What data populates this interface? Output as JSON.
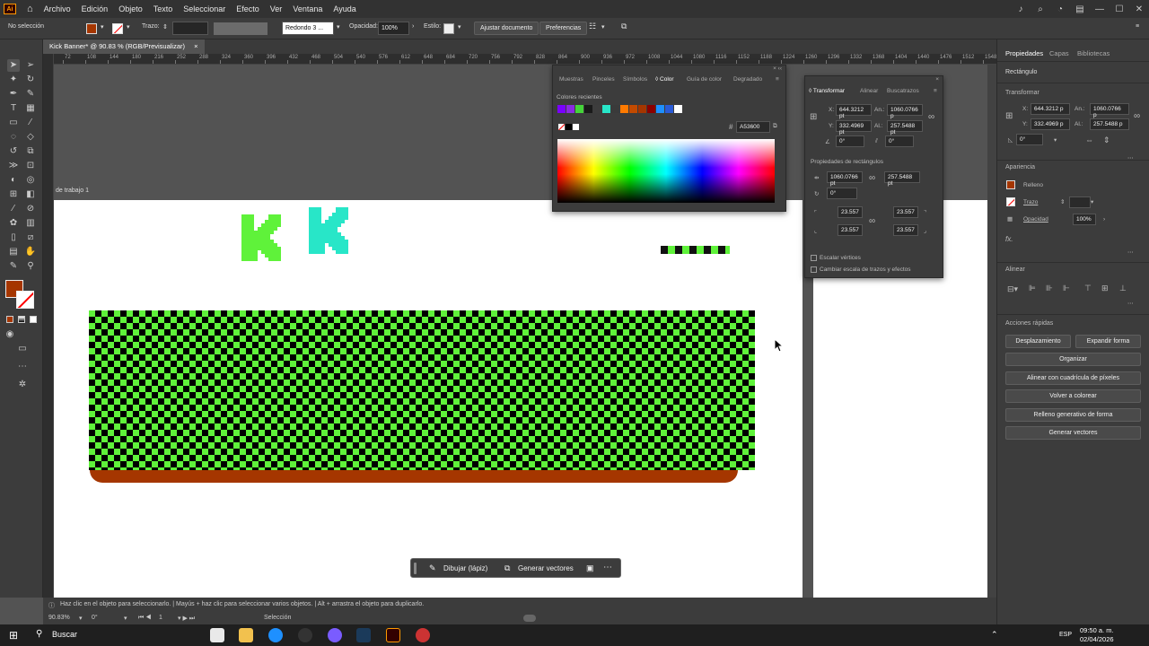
{
  "menubar": {
    "app_logo": "Ai",
    "items": [
      "Archivo",
      "Edición",
      "Objeto",
      "Texto",
      "Seleccionar",
      "Efecto",
      "Ver",
      "Ventana",
      "Ayuda"
    ]
  },
  "control_bar": {
    "selection": "No selección",
    "stroke_label": "Trazo:",
    "brush": "Redondo 3 ...",
    "opacity_label": "Opacidad:",
    "opacity_value": "100%",
    "style_label": "Estilo:",
    "fit_document": "Ajustar documento",
    "preferences": "Preferencias",
    "fill_color": "#a53600"
  },
  "document_tab": {
    "title": "Kick Banner* @ 90.83 % (RGB/Previsualizar)",
    "close": "×"
  },
  "ruler": {
    "ticks": [
      "72",
      "108",
      "144",
      "180",
      "216",
      "252",
      "288",
      "324",
      "360",
      "396",
      "432",
      "468",
      "504",
      "540",
      "576",
      "612",
      "648",
      "684",
      "720",
      "756",
      "792",
      "828",
      "864",
      "900",
      "936",
      "972",
      "1008",
      "1044",
      "1080",
      "1116",
      "1152",
      "1188",
      "1224",
      "1260",
      "1296",
      "1332",
      "1368",
      "1404",
      "1440",
      "1476",
      "1512",
      "1548"
    ]
  },
  "canvas": {
    "artboard_label": "de trabajo 1",
    "kick_letters": [
      "K",
      "K"
    ],
    "checker_green": "#5ff23a",
    "ground_color": "#a53600"
  },
  "color_panel": {
    "tabs": [
      "Muestras",
      "Pinceles",
      "Símbolos",
      "Color",
      "Guía de color",
      "Degradado"
    ],
    "active_tab": "Color",
    "recent_label": "Colores recientes",
    "recent_colors": [
      "#7a00ff",
      "#8a2be2",
      "#45d43a",
      "#1a1a1a",
      "#3d3d3d",
      "#28e6c8",
      "#3a3a3a",
      "#ff7a00",
      "#c24a00",
      "#a53600",
      "#8b0000",
      "#1e90ff",
      "#2a5bd7",
      "#ffffff"
    ],
    "hex_value": "A53600"
  },
  "transform_panel": {
    "tabs": [
      "Transformar",
      "Alinear",
      "Buscatrazos"
    ],
    "x": "644.3212 pt",
    "y": "332.4969 pt",
    "w": "1060.0766 p",
    "h": "257.5488 pt",
    "angle": "0°",
    "shear": "0°",
    "rect_props_label": "Propiedades de rectángulos",
    "rect_w": "1060.0766 pt",
    "rect_h": "257.5488 pt",
    "rect_angle": "0°",
    "radius_1": "23.557",
    "radius_2": "23.557",
    "radius_3": "23.557",
    "radius_4": "23.557",
    "scale_corners": "Escalar vértices",
    "scale_strokes": "Cambiar escala de trazos y efectos"
  },
  "properties_panel": {
    "tabs": [
      "Propiedades",
      "Capas",
      "Bibliotecas"
    ],
    "object_type": "Rectángulo",
    "transform_label": "Transformar",
    "x": "644.3212 p",
    "y": "332.4969 p",
    "w": "1060.0766 p",
    "h": "257.5488 p",
    "angle": "0°",
    "appearance_label": "Apariencia",
    "fill_label": "Relleno",
    "stroke_label": "Trazo",
    "opacity_label": "Opacidad",
    "opacity_value": "100%",
    "fx_label": "fx.",
    "align_label": "Alinear",
    "quick_actions_label": "Acciones rápidas",
    "btn_offset": "Desplazamiento",
    "btn_expand": "Expandir forma",
    "btn_arrange": "Organizar",
    "btn_pixel_grid": "Alinear con cuadrícula de píxeles",
    "btn_recolor": "Volver a colorear",
    "btn_gen_fill": "Relleno generativo de forma",
    "btn_gen_vectors": "Generar vectores"
  },
  "draw_bar": {
    "draw": "Dibujar (lápiz)",
    "generate": "Generar vectores"
  },
  "status_bar": {
    "hint": "Haz clic en el objeto para seleccionarlo.  |  Mayús + haz clic para seleccionar varios objetos.  |  Alt + arrastra el objeto para duplicarlo.",
    "zoom": "90.83%",
    "rotation": "0°",
    "artboard_num": "1",
    "tool": "Selección"
  },
  "taskbar": {
    "search": "Buscar",
    "lang": "ESP",
    "time": "09:50 a. m.",
    "date": "02/04/2026"
  }
}
